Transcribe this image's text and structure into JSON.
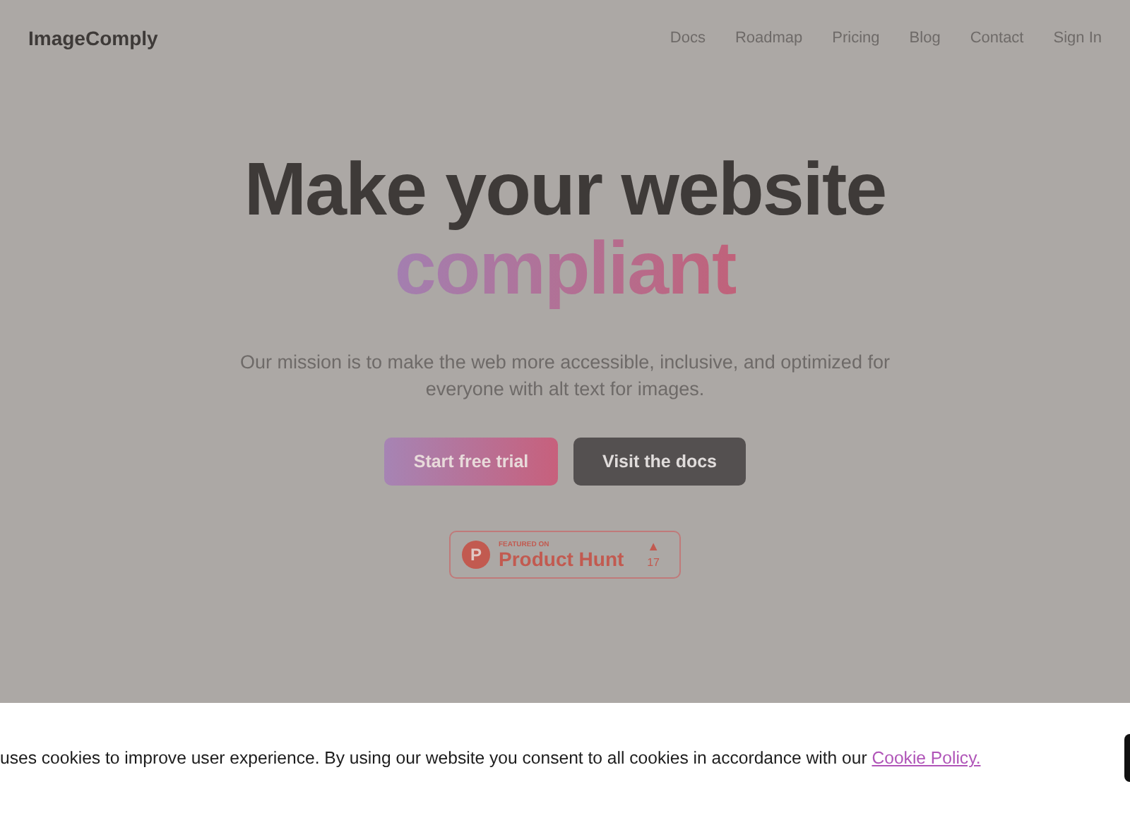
{
  "header": {
    "logo": "ImageComply",
    "nav": [
      "Docs",
      "Roadmap",
      "Pricing",
      "Blog",
      "Contact",
      "Sign In"
    ]
  },
  "hero": {
    "title_line_1": "Make your website",
    "title_line_2": "compliant",
    "subtitle": "Our mission is to make the web more accessible, inclusive, and optimized for everyone with alt text for images.",
    "buttons": [
      {
        "label": "Start free trial",
        "kind": "primary"
      },
      {
        "label": "Visit the docs",
        "kind": "secondary"
      }
    ]
  },
  "badge": {
    "icon_letter": "P",
    "caption": "FEATURED ON",
    "name": "Product Hunt",
    "arrow": "▲",
    "count": "17"
  },
  "cookie_banner": {
    "text": "uses cookies to improve user experience. By using our website you consent to all cookies in accordance with our",
    "link": "Cookie Policy."
  }
}
